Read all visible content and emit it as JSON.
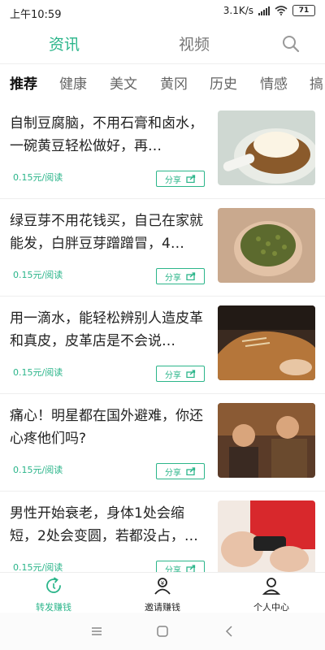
{
  "status_bar": {
    "time": "上午10:59",
    "speed": "3.1K/s",
    "battery": "71"
  },
  "top_tabs": {
    "news": "资讯",
    "video": "视频"
  },
  "categories": [
    "推荐",
    "健康",
    "美文",
    "黄冈",
    "历史",
    "情感",
    "搞"
  ],
  "articles": [
    {
      "title": "自制豆腐脑，不用石膏和卤水，一碗黄豆轻松做好，再…",
      "price": "0.15元/阅读",
      "share": "分享"
    },
    {
      "title": "绿豆芽不用花钱买，自己在家就能发，白胖豆芽蹭蹭冒，4…",
      "price": "0.15元/阅读",
      "share": "分享"
    },
    {
      "title": "用一滴水，能轻松辨别人造皮革和真皮，皮革店是不会说…",
      "price": "0.15元/阅读",
      "share": "分享"
    },
    {
      "title": "痛心！明星都在国外避难，你还心疼他们吗?",
      "price": "0.15元/阅读",
      "share": "分享"
    },
    {
      "title": "男性开始衰老，身体1处会缩短，2处会变圆，若都没占，…",
      "price": "0.15元/阅读",
      "share": "分享"
    }
  ],
  "bottom_nav": {
    "share_earn": "转发赚钱",
    "invite_earn": "邀请赚钱",
    "profile": "个人中心"
  },
  "colors": {
    "accent": "#2bb58a"
  },
  "icons": [
    "search-icon",
    "share-icon",
    "refresh-earn-icon",
    "invite-icon",
    "user-icon",
    "wifi-icon",
    "signal-icon"
  ]
}
